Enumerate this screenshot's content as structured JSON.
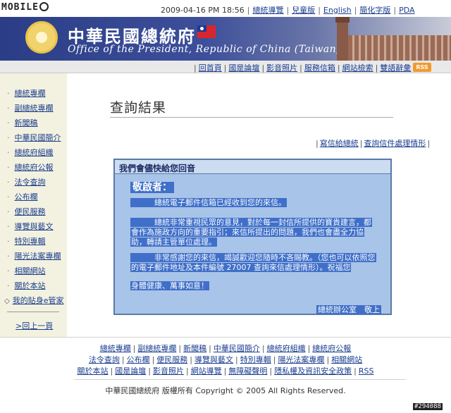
{
  "watermark_logo": "MOBILE",
  "top_bar": {
    "datetime": "2009-04-16 PM 18:56",
    "links": [
      "總統導覽",
      "兒童版",
      "English",
      "簡化字版",
      "PDA"
    ]
  },
  "header": {
    "title_zh": "中華民國總統府",
    "title_en": "Office of the President, Republic of China (Taiwan)"
  },
  "nav": {
    "links": [
      "回首頁",
      "國是論壇",
      "影音照片",
      "服務信箱",
      "網站檢索",
      "雙語辭彙"
    ],
    "rss": "RSS"
  },
  "sidebar": {
    "items": [
      "總統專欄",
      "副總統專欄",
      "新聞稿",
      "中華民國簡介",
      "總統府組織",
      "總統府公報",
      "法令查詢",
      "公布欄",
      "便民服務",
      "導覽與藝文",
      "特別專輯",
      "陽光法案專欄",
      "相關網站",
      "關於本站",
      "我的貼身e管家"
    ],
    "back": ">回上一頁"
  },
  "main": {
    "title": "查詢結果",
    "action_links": [
      "寫信給總統",
      "查詢信件處理情形"
    ],
    "panel": {
      "header": "我們會儘快給您回音",
      "greeting": "敬啟者：",
      "para1": "總統電子郵件信箱已經收到您的來信。",
      "para2": "總統非常重視民眾的意見，對於每一封信所提供的寶貴建言，都會作為施政方向的重要指引；來信所提出的問題，我們也會盡全力協助，轉請主管單位處理。",
      "para3": "非常感謝您的來信，竭誠歡迎您隨時不吝賜教。（您也可以依照您的電子郵件地址及本件編號 27007 查詢來信處理情形）。祝福您",
      "wish": "身體健康、萬事如意！",
      "signature": "總統辦公室　敬上"
    }
  },
  "footer": {
    "row1": [
      "總統專欄",
      "副總統專欄",
      "新聞稿",
      "中華民國簡介",
      "總統府組織",
      "總統府公報"
    ],
    "row2": [
      "法令查詢",
      "公布欄",
      "便民服務",
      "導覽與藝文",
      "特別專輯",
      "陽光法案專欄",
      "相關網站"
    ],
    "row3": [
      "關於本站",
      "國是論壇",
      "影音照片",
      "網站導覽",
      "無障礙聲明",
      "隱私權及資訊安全政策",
      "RSS"
    ],
    "copyright": "中華民國總統府 版權所有 Copyright © 2005 All Rights Reserved.",
    "watermark": "#294088"
  },
  "colors": {
    "banner_blue": "#2a3d86",
    "link_blue": "#1a3d8f",
    "panel_blue": "#a8c4e8",
    "highlight_blue": "#3f6fc8",
    "sidebar_bg": "#f3f2e0",
    "rss_orange": "#f29a2e"
  }
}
